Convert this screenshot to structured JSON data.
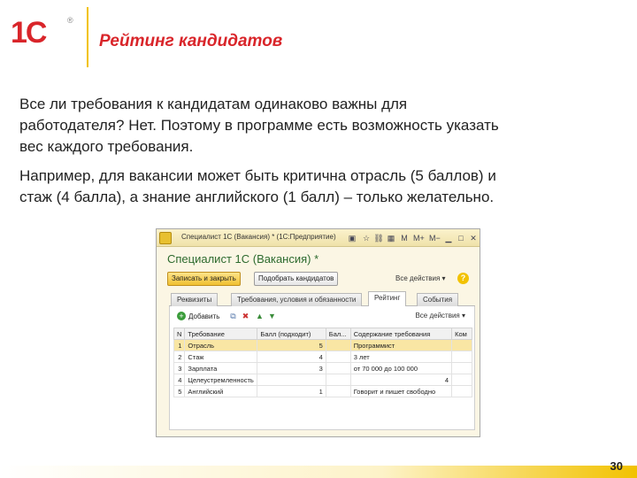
{
  "header": {
    "logo_text": "1С",
    "registered_mark": "®",
    "title": "Рейтинг кандидатов"
  },
  "body": {
    "paragraph1_line1": "Все ли требования к кандидатам одинаково важны для",
    "paragraph1_line2": "работодателя? Нет. Поэтому в программе есть возможность указать",
    "paragraph1_line3": "вес каждого требования.",
    "paragraph2_line1": "Например, для вакансии может быть критична отрасль (5 баллов) и",
    "paragraph2_line2": "стаж (4 балла), а знание английского (1 балл) – только желательно."
  },
  "window": {
    "caption": "Специалист 1С (Вакансия) * (1С:Предприятие)",
    "toolbar_icons": [
      "window-icon",
      "star-icon",
      "link-icon",
      "calculator-icon",
      "m-icon",
      "m-plus-icon",
      "m-minus-icon",
      "minimize-icon",
      "maximize-icon",
      "close-icon"
    ],
    "doc_title": "Специалист 1С (Вакансия) *",
    "save_close_button": "Записать и закрыть",
    "select_candidates_button": "Подобрать кандидатов",
    "all_actions": "Все действия ▾",
    "help_icon": "?",
    "tabs": [
      "Реквизиты",
      "Требования, условия и обязанности",
      "Рейтинг",
      "События"
    ],
    "active_tab_index": 2,
    "table_toolbar": {
      "add_label": "Добавить",
      "icons": [
        "copy-icon",
        "delete-icon",
        "move-up-icon",
        "move-down-icon"
      ],
      "all_actions": "Все действия ▾"
    },
    "table": {
      "columns": [
        "N",
        "Требование",
        "Балл (подходит)",
        "Бал...",
        "Содержание требования",
        "Ком"
      ],
      "rows": [
        {
          "n": "1",
          "req": "Отрасль",
          "score": "5",
          "score2": "",
          "content": "Программист",
          "com": ""
        },
        {
          "n": "2",
          "req": "Стаж",
          "score": "4",
          "score2": "",
          "content": "3 лет",
          "com": ""
        },
        {
          "n": "3",
          "req": "Зарплата",
          "score": "3",
          "score2": "",
          "content": "от 70 000 до 100 000",
          "com": ""
        },
        {
          "n": "4",
          "req": "Целеустремленность",
          "score": "",
          "score2": "",
          "content": "4",
          "com": ""
        },
        {
          "n": "5",
          "req": "Английский",
          "score": "1",
          "score2": "",
          "content": "Говорит и пишет свободно",
          "com": ""
        }
      ],
      "selected_row": 0
    }
  },
  "footer": {
    "page_number": "30"
  },
  "colors": {
    "brand_red": "#d9252a",
    "accent_yellow": "#f2c200",
    "doc_title_green": "#2d6a2e"
  }
}
